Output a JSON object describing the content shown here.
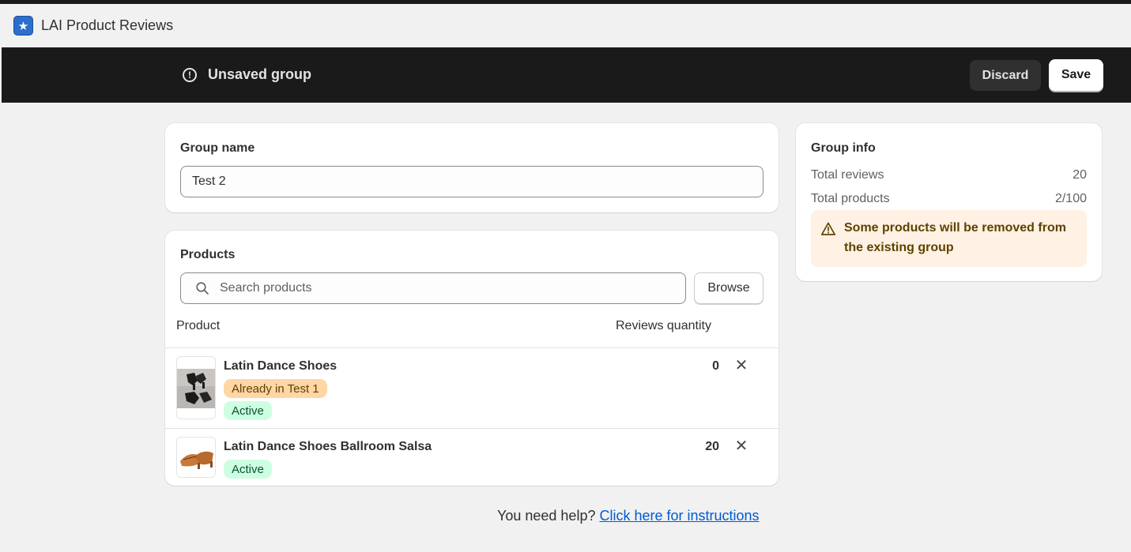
{
  "app": {
    "title": "LAI Product Reviews",
    "logo_icon": "star-icon"
  },
  "savebar": {
    "title": "Unsaved group",
    "discard_label": "Discard",
    "save_label": "Save"
  },
  "group": {
    "label": "Group name",
    "value": "Test 2"
  },
  "products": {
    "label": "Products",
    "search_placeholder": "Search products",
    "browse_label": "Browse",
    "columns": {
      "product": "Product",
      "reviews": "Reviews quantity"
    },
    "rows": [
      {
        "name": "Latin Dance Shoes",
        "conflict_badge": "Already in Test 1",
        "status": "Active",
        "reviews": "0"
      },
      {
        "name": "Latin Dance Shoes Ballroom Salsa",
        "status": "Active",
        "reviews": "20"
      }
    ]
  },
  "info": {
    "label": "Group info",
    "total_reviews_label": "Total reviews",
    "total_reviews_value": "20",
    "total_products_label": "Total products",
    "total_products_value": "2/100",
    "warning": "Some products will be removed from the existing group"
  },
  "help": {
    "text": "You need help?",
    "link": "Click here for instructions"
  },
  "colors": {
    "accent": "#005bd3",
    "savebar": "#1a1a1a",
    "warning_bg": "#fff1e3",
    "badge_active": "#cdfee1",
    "badge_warning": "#ffd6a4"
  }
}
